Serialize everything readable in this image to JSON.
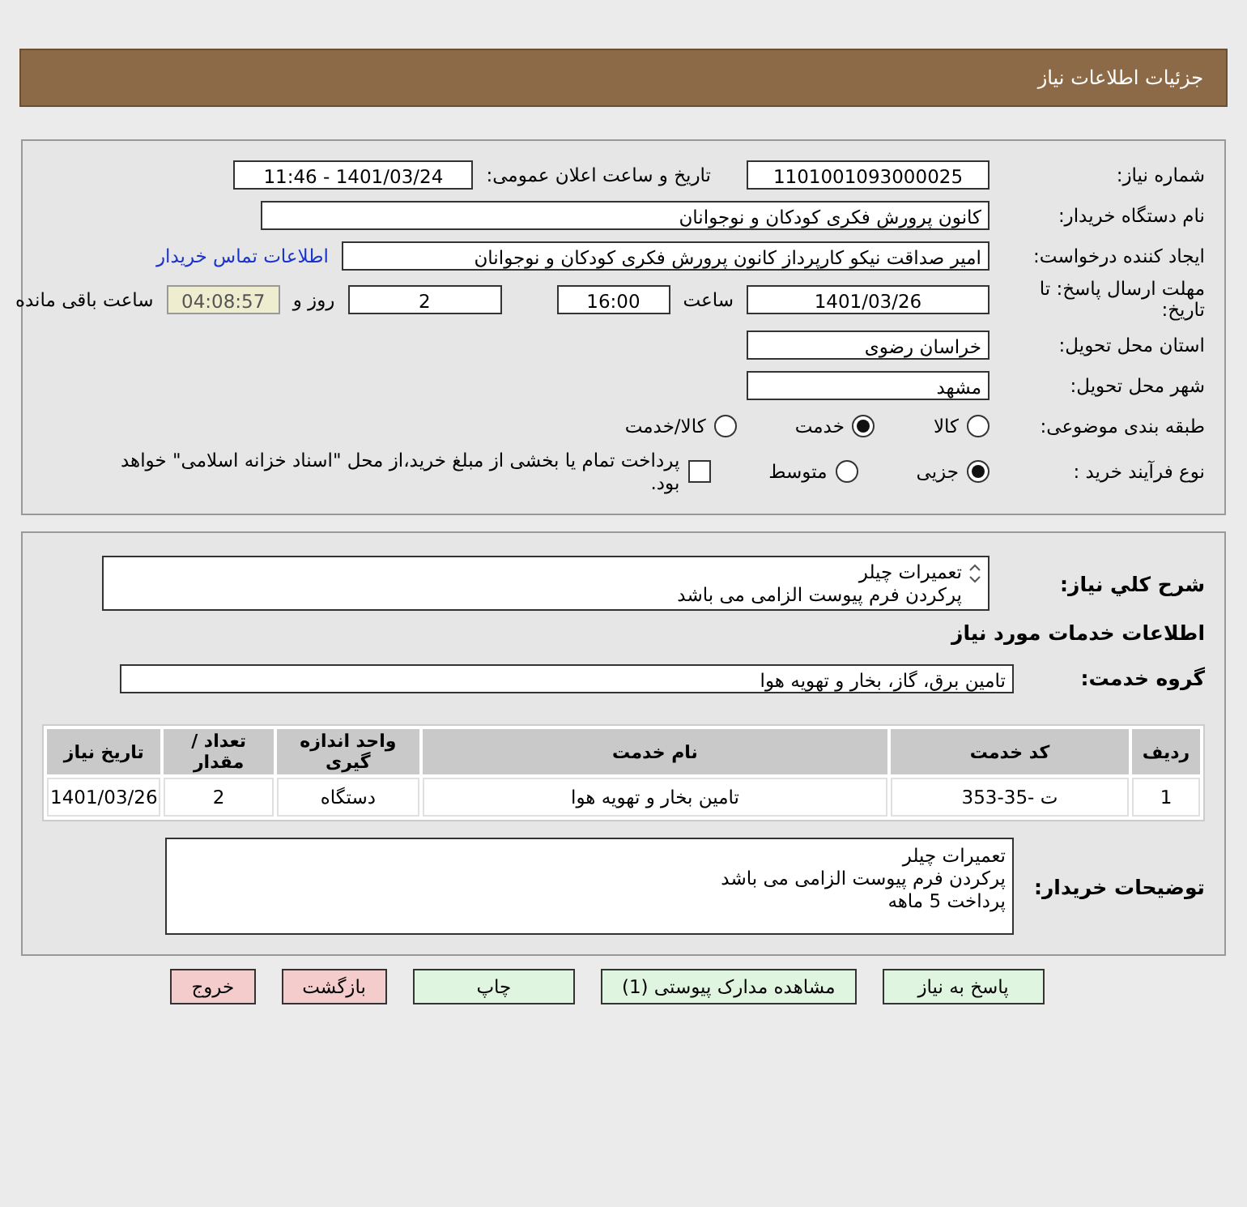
{
  "header": {
    "title": "جزئیات اطلاعات نیاز"
  },
  "need_number": {
    "label": "شماره نیاز:",
    "value": "1101001093000025"
  },
  "announce": {
    "label": "تاریخ و ساعت اعلان عمومی:",
    "value": "1401/03/24 - 11:46"
  },
  "buyer_org": {
    "label": "نام دستگاه خریدار:",
    "value": "کانون پرورش فکری کودکان و نوجوانان"
  },
  "requester": {
    "label": "ایجاد کننده درخواست:",
    "value": "امیر صداقت نیکو کارپرداز کانون پرورش فکری کودکان و نوجوانان",
    "link": "اطلاعات تماس خریدار"
  },
  "deadline": {
    "label": "مهلت ارسال پاسخ: تا تاریخ:",
    "date": "1401/03/26",
    "time_label": "ساعت",
    "time": "16:00",
    "days": "2",
    "days_label": "روز و",
    "remaining": "04:08:57",
    "remaining_label": "ساعت باقی مانده"
  },
  "province": {
    "label": "استان محل تحویل:",
    "value": "خراسان رضوی"
  },
  "city": {
    "label": "شهر محل تحویل:",
    "value": "مشهد"
  },
  "category": {
    "label": "طبقه بندی موضوعی:",
    "options": [
      {
        "label": "کالا",
        "selected": false
      },
      {
        "label": "خدمت",
        "selected": true
      },
      {
        "label": "کالا/خدمت",
        "selected": false
      }
    ]
  },
  "purchase_type": {
    "label": "نوع فرآیند خرید :",
    "options": [
      {
        "label": "جزیی",
        "selected": true
      },
      {
        "label": "متوسط",
        "selected": false
      }
    ],
    "payment": {
      "label": "پرداخت تمام یا بخشی از مبلغ خرید،از محل \"اسناد خزانه اسلامی\" خواهد بود.",
      "checked": false
    }
  },
  "description": {
    "label": "شرح کلي نياز:",
    "lines": [
      "تعمیرات چیلر",
      "پرکردن فرم پیوست الزامی می باشد"
    ]
  },
  "services_heading": "اطلاعات خدمات مورد نیاز",
  "service_group": {
    "label": "گروه خدمت:",
    "value": "تامین برق، گاز، بخار و تهویه هوا"
  },
  "table": {
    "columns": [
      "ردیف",
      "کد خدمت",
      "نام خدمت",
      "واحد اندازه گیری",
      "تعداد / مقدار",
      "تاریخ نیاز"
    ],
    "rows": [
      [
        "1",
        "ت -35-353",
        "تامین بخار و تهویه هوا",
        "دستگاه",
        "2",
        "1401/03/26"
      ]
    ]
  },
  "buyer_notes": {
    "label": "توضیحات خریدار:",
    "lines": [
      "تعمیرات چیلر",
      "پرکردن فرم پیوست الزامی می باشد",
      "پرداخت 5 ماهه"
    ]
  },
  "buttons": [
    {
      "label": "پاسخ به نیاز",
      "kind": "action"
    },
    {
      "label": "مشاهده مدارک پیوستی (1)",
      "kind": "action"
    },
    {
      "label": "چاپ",
      "kind": "action"
    },
    {
      "label": "بازگشت",
      "kind": "exit"
    },
    {
      "label": "خروج",
      "kind": "exit"
    }
  ]
}
